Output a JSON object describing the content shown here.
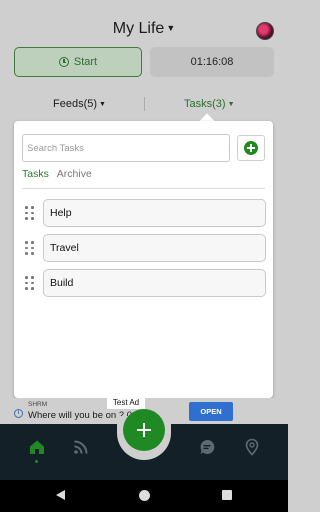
{
  "header": {
    "title": "My Life",
    "avatar_icon": "avatar-icon"
  },
  "controls": {
    "start_label": "Start",
    "timer": "01:16:08"
  },
  "segments": {
    "feeds": "Feeds(5)",
    "tasks": "Tasks(3)"
  },
  "popup": {
    "search_placeholder": "Search Tasks",
    "tabs": [
      "Tasks",
      "Archive"
    ],
    "tasks": [
      {
        "label": "Help"
      },
      {
        "label": "Travel"
      },
      {
        "label": "Build"
      }
    ]
  },
  "ad": {
    "badge": "Test Ad",
    "source": "SHRM",
    "text": "Where will you be on 2.0-pov?",
    "cta": "OPEN"
  },
  "colors": {
    "accent_green": "#1f8a24",
    "nav_bg": "#142028",
    "ad_button": "#2f6fd0"
  }
}
